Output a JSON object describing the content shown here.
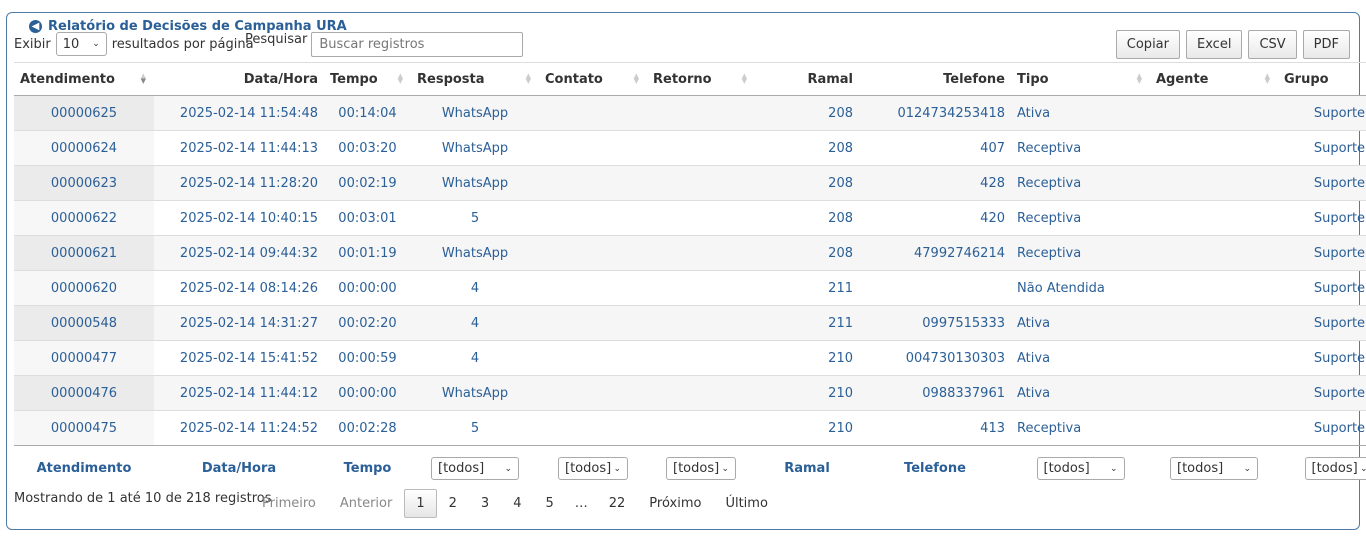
{
  "panel": {
    "title": "Relatório de Decisões de Campanha URA"
  },
  "length": {
    "prefix": "Exibir",
    "value": "10",
    "suffix": "resultados por página"
  },
  "search": {
    "label": "Pesquisar",
    "placeholder": "Buscar registros"
  },
  "buttons": {
    "copy": "Copiar",
    "excel": "Excel",
    "csv": "CSV",
    "pdf": "PDF"
  },
  "columns": [
    "Atendimento",
    "Data/Hora",
    "Tempo",
    "Resposta",
    "Contato",
    "Retorno",
    "Ramal",
    "Telefone",
    "Tipo",
    "Agente",
    "Grupo"
  ],
  "rows": [
    [
      "00000625",
      "2025-02-14 11:54:48",
      "00:14:04",
      "WhatsApp",
      "",
      "",
      "208",
      "0124734253418",
      "Ativa",
      "",
      "Suporte"
    ],
    [
      "00000624",
      "2025-02-14 11:44:13",
      "00:03:20",
      "WhatsApp",
      "",
      "",
      "208",
      "407",
      "Receptiva",
      "",
      "Suporte"
    ],
    [
      "00000623",
      "2025-02-14 11:28:20",
      "00:02:19",
      "WhatsApp",
      "",
      "",
      "208",
      "428",
      "Receptiva",
      "",
      "Suporte"
    ],
    [
      "00000622",
      "2025-02-14 10:40:15",
      "00:03:01",
      "5",
      "",
      "",
      "208",
      "420",
      "Receptiva",
      "",
      "Suporte"
    ],
    [
      "00000621",
      "2025-02-14 09:44:32",
      "00:01:19",
      "WhatsApp",
      "",
      "",
      "208",
      "47992746214",
      "Receptiva",
      "",
      "Suporte"
    ],
    [
      "00000620",
      "2025-02-14 08:14:26",
      "00:00:00",
      "4",
      "",
      "",
      "211",
      "",
      "Não Atendida",
      "",
      "Suporte"
    ],
    [
      "00000548",
      "2025-02-14 14:31:27",
      "00:02:20",
      "4",
      "",
      "",
      "211",
      "0997515333",
      "Ativa",
      "",
      "Suporte"
    ],
    [
      "00000477",
      "2025-02-14 15:41:52",
      "00:00:59",
      "4",
      "",
      "",
      "210",
      "004730130303",
      "Ativa",
      "",
      "Suporte"
    ],
    [
      "00000476",
      "2025-02-14 11:44:12",
      "00:00:00",
      "WhatsApp",
      "",
      "",
      "210",
      "0988337961",
      "Ativa",
      "",
      "Suporte"
    ],
    [
      "00000475",
      "2025-02-14 11:24:52",
      "00:02:28",
      "5",
      "",
      "",
      "210",
      "413",
      "Receptiva",
      "",
      "Suporte"
    ]
  ],
  "footer": {
    "titles": {
      "atendimento": "Atendimento",
      "datahora": "Data/Hora",
      "tempo": "Tempo",
      "ramal": "Ramal",
      "telefone": "Telefone"
    },
    "filter_value": "[todos]"
  },
  "info": "Mostrando de 1 até 10 de 218 registros",
  "pagination": {
    "first": "Primeiro",
    "prev": "Anterior",
    "pages": [
      "1",
      "2",
      "3",
      "4",
      "5"
    ],
    "ellipsis": "…",
    "last_page": "22",
    "next": "Próximo",
    "last": "Último"
  }
}
